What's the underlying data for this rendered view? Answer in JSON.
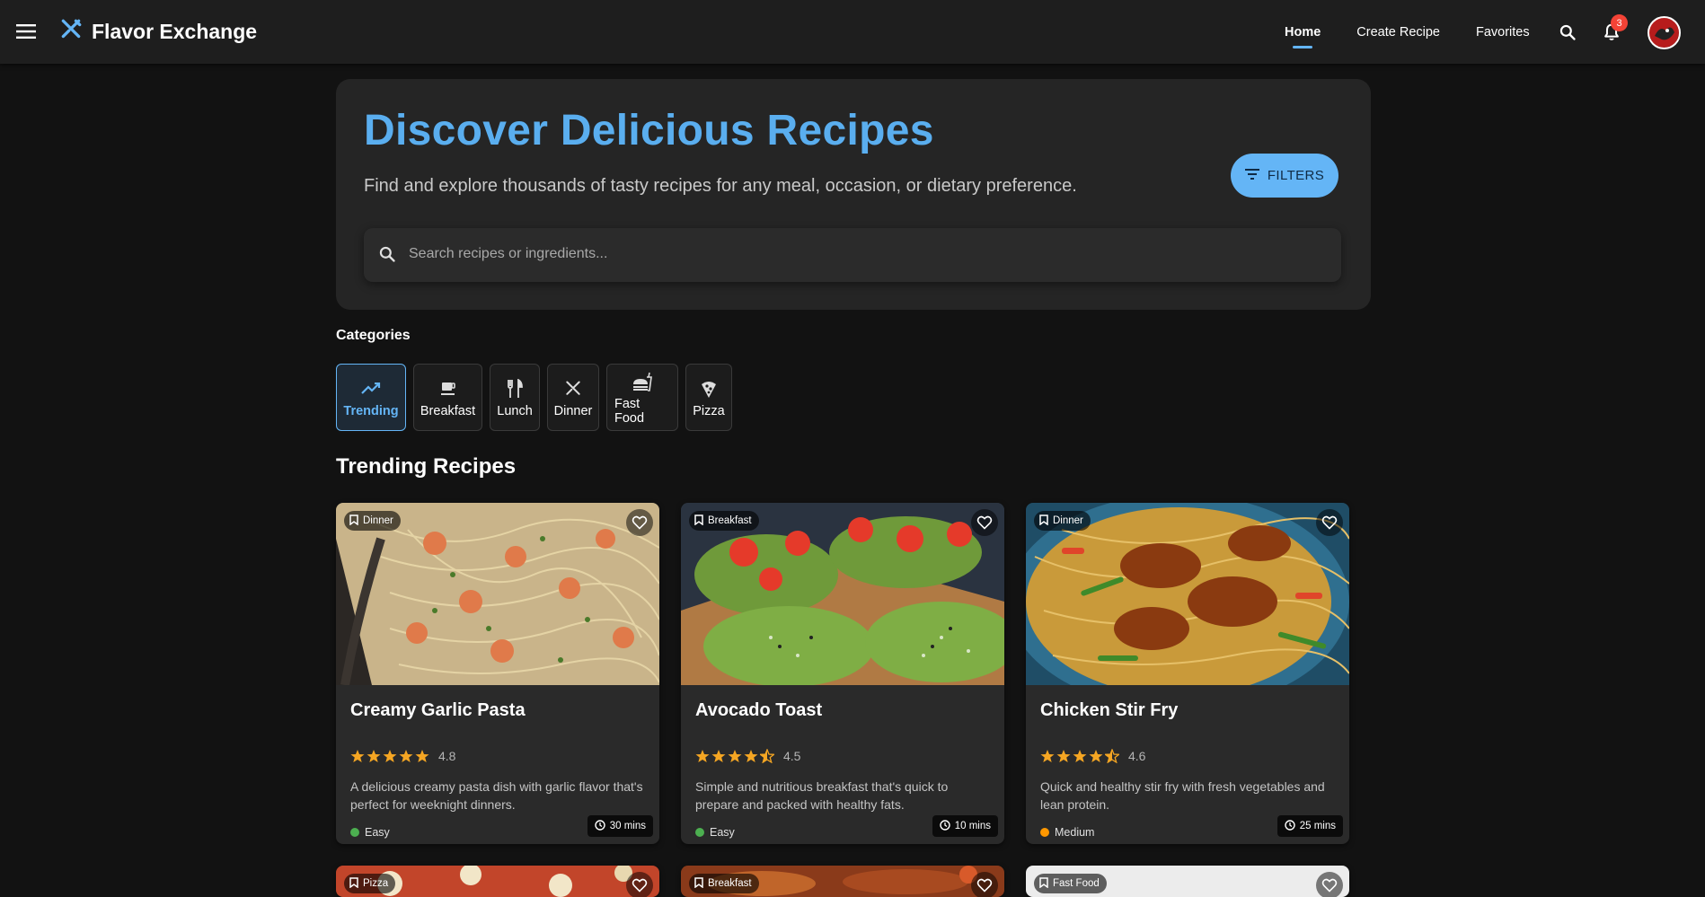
{
  "app": {
    "name": "Flavor Exchange",
    "brand_color": "#64b5f6"
  },
  "nav": {
    "links": [
      {
        "label": "Home",
        "active": true
      },
      {
        "label": "Create Recipe",
        "active": false
      },
      {
        "label": "Favorites",
        "active": false
      }
    ],
    "notification_count": "3"
  },
  "hero": {
    "title": "Discover Delicious Recipes",
    "subtitle": "Find and explore thousands of tasty recipes for any meal, occasion, or dietary preference.",
    "search_placeholder": "Search recipes or ingredients...",
    "search_value": "",
    "filters_label": "FILTERS"
  },
  "categories": {
    "heading": "Categories",
    "items": [
      {
        "label": "Trending",
        "icon": "trending-icon",
        "active": true
      },
      {
        "label": "Breakfast",
        "icon": "coffee-icon",
        "active": false
      },
      {
        "label": "Lunch",
        "icon": "utensils-icon",
        "active": false
      },
      {
        "label": "Dinner",
        "icon": "dinner-icon",
        "active": false
      },
      {
        "label": "Fast Food",
        "icon": "fastfood-icon",
        "active": false
      },
      {
        "label": "Pizza",
        "icon": "pizza-icon",
        "active": false
      }
    ]
  },
  "recipes": {
    "heading": "Trending Recipes",
    "items": [
      {
        "category": "Dinner",
        "time": "30 mins",
        "title": "Creamy Garlic Pasta",
        "rating": "4.8",
        "stars": 5,
        "description": "A delicious creamy pasta dish with garlic flavor that's perfect for weeknight dinners.",
        "difficulty": "Easy",
        "difficulty_color": "#4caf50"
      },
      {
        "category": "Breakfast",
        "time": "10 mins",
        "title": "Avocado Toast",
        "rating": "4.5",
        "stars": 4.5,
        "description": "Simple and nutritious breakfast that's quick to prepare and packed with healthy fats.",
        "difficulty": "Easy",
        "difficulty_color": "#4caf50"
      },
      {
        "category": "Dinner",
        "time": "25 mins",
        "title": "Chicken Stir Fry",
        "rating": "4.6",
        "stars": 4.5,
        "description": "Quick and healthy stir fry with fresh vegetables and lean protein.",
        "difficulty": "Medium",
        "difficulty_color": "#ff9800"
      }
    ],
    "partial_items": [
      {
        "category": "Pizza"
      },
      {
        "category": "Breakfast"
      },
      {
        "category": "Fast Food"
      }
    ]
  },
  "colors": {
    "star": "#f5a623",
    "accent": "#64b5f6",
    "hero_title": "#5aaeef"
  }
}
